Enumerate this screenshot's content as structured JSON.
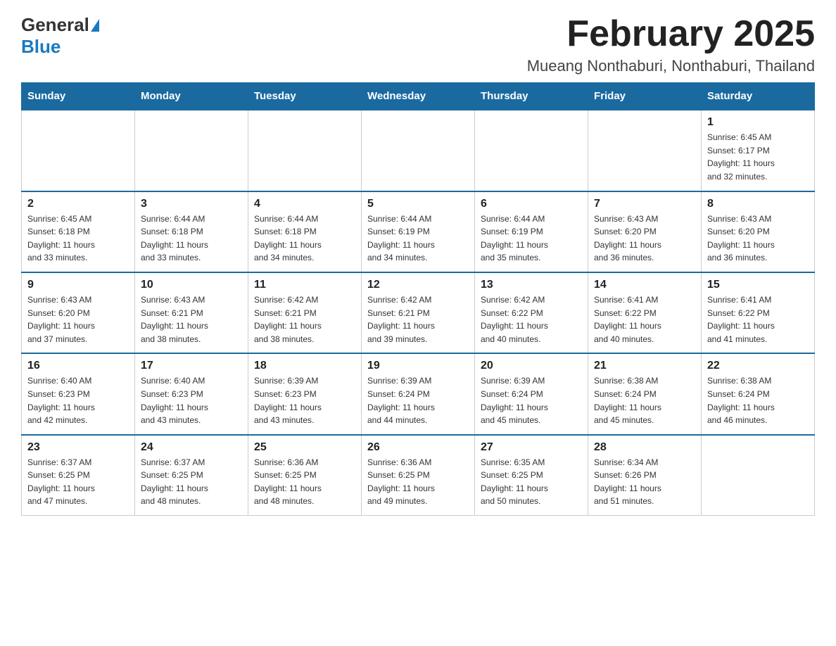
{
  "header": {
    "logo_general": "General",
    "logo_blue": "Blue",
    "month_title": "February 2025",
    "location": "Mueang Nonthaburi, Nonthaburi, Thailand"
  },
  "days_of_week": [
    "Sunday",
    "Monday",
    "Tuesday",
    "Wednesday",
    "Thursday",
    "Friday",
    "Saturday"
  ],
  "weeks": [
    [
      {
        "day": "",
        "info": ""
      },
      {
        "day": "",
        "info": ""
      },
      {
        "day": "",
        "info": ""
      },
      {
        "day": "",
        "info": ""
      },
      {
        "day": "",
        "info": ""
      },
      {
        "day": "",
        "info": ""
      },
      {
        "day": "1",
        "info": "Sunrise: 6:45 AM\nSunset: 6:17 PM\nDaylight: 11 hours\nand 32 minutes."
      }
    ],
    [
      {
        "day": "2",
        "info": "Sunrise: 6:45 AM\nSunset: 6:18 PM\nDaylight: 11 hours\nand 33 minutes."
      },
      {
        "day": "3",
        "info": "Sunrise: 6:44 AM\nSunset: 6:18 PM\nDaylight: 11 hours\nand 33 minutes."
      },
      {
        "day": "4",
        "info": "Sunrise: 6:44 AM\nSunset: 6:18 PM\nDaylight: 11 hours\nand 34 minutes."
      },
      {
        "day": "5",
        "info": "Sunrise: 6:44 AM\nSunset: 6:19 PM\nDaylight: 11 hours\nand 34 minutes."
      },
      {
        "day": "6",
        "info": "Sunrise: 6:44 AM\nSunset: 6:19 PM\nDaylight: 11 hours\nand 35 minutes."
      },
      {
        "day": "7",
        "info": "Sunrise: 6:43 AM\nSunset: 6:20 PM\nDaylight: 11 hours\nand 36 minutes."
      },
      {
        "day": "8",
        "info": "Sunrise: 6:43 AM\nSunset: 6:20 PM\nDaylight: 11 hours\nand 36 minutes."
      }
    ],
    [
      {
        "day": "9",
        "info": "Sunrise: 6:43 AM\nSunset: 6:20 PM\nDaylight: 11 hours\nand 37 minutes."
      },
      {
        "day": "10",
        "info": "Sunrise: 6:43 AM\nSunset: 6:21 PM\nDaylight: 11 hours\nand 38 minutes."
      },
      {
        "day": "11",
        "info": "Sunrise: 6:42 AM\nSunset: 6:21 PM\nDaylight: 11 hours\nand 38 minutes."
      },
      {
        "day": "12",
        "info": "Sunrise: 6:42 AM\nSunset: 6:21 PM\nDaylight: 11 hours\nand 39 minutes."
      },
      {
        "day": "13",
        "info": "Sunrise: 6:42 AM\nSunset: 6:22 PM\nDaylight: 11 hours\nand 40 minutes."
      },
      {
        "day": "14",
        "info": "Sunrise: 6:41 AM\nSunset: 6:22 PM\nDaylight: 11 hours\nand 40 minutes."
      },
      {
        "day": "15",
        "info": "Sunrise: 6:41 AM\nSunset: 6:22 PM\nDaylight: 11 hours\nand 41 minutes."
      }
    ],
    [
      {
        "day": "16",
        "info": "Sunrise: 6:40 AM\nSunset: 6:23 PM\nDaylight: 11 hours\nand 42 minutes."
      },
      {
        "day": "17",
        "info": "Sunrise: 6:40 AM\nSunset: 6:23 PM\nDaylight: 11 hours\nand 43 minutes."
      },
      {
        "day": "18",
        "info": "Sunrise: 6:39 AM\nSunset: 6:23 PM\nDaylight: 11 hours\nand 43 minutes."
      },
      {
        "day": "19",
        "info": "Sunrise: 6:39 AM\nSunset: 6:24 PM\nDaylight: 11 hours\nand 44 minutes."
      },
      {
        "day": "20",
        "info": "Sunrise: 6:39 AM\nSunset: 6:24 PM\nDaylight: 11 hours\nand 45 minutes."
      },
      {
        "day": "21",
        "info": "Sunrise: 6:38 AM\nSunset: 6:24 PM\nDaylight: 11 hours\nand 45 minutes."
      },
      {
        "day": "22",
        "info": "Sunrise: 6:38 AM\nSunset: 6:24 PM\nDaylight: 11 hours\nand 46 minutes."
      }
    ],
    [
      {
        "day": "23",
        "info": "Sunrise: 6:37 AM\nSunset: 6:25 PM\nDaylight: 11 hours\nand 47 minutes."
      },
      {
        "day": "24",
        "info": "Sunrise: 6:37 AM\nSunset: 6:25 PM\nDaylight: 11 hours\nand 48 minutes."
      },
      {
        "day": "25",
        "info": "Sunrise: 6:36 AM\nSunset: 6:25 PM\nDaylight: 11 hours\nand 48 minutes."
      },
      {
        "day": "26",
        "info": "Sunrise: 6:36 AM\nSunset: 6:25 PM\nDaylight: 11 hours\nand 49 minutes."
      },
      {
        "day": "27",
        "info": "Sunrise: 6:35 AM\nSunset: 6:25 PM\nDaylight: 11 hours\nand 50 minutes."
      },
      {
        "day": "28",
        "info": "Sunrise: 6:34 AM\nSunset: 6:26 PM\nDaylight: 11 hours\nand 51 minutes."
      },
      {
        "day": "",
        "info": ""
      }
    ]
  ]
}
